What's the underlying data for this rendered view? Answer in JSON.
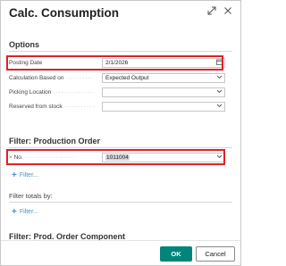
{
  "dialog": {
    "title": "Calc. Consumption"
  },
  "options": {
    "section_title": "Options",
    "posting_date": {
      "label": "Posting Date",
      "value": "2/1/2026",
      "icon": "calendar-icon"
    },
    "calculation_based_on": {
      "label": "Calculation Based on",
      "value": "Expected Output",
      "icon": "chevron-down-icon"
    },
    "picking_location": {
      "label": "Picking Location",
      "value": "",
      "icon": "chevron-down-icon"
    },
    "reserved_from_stock": {
      "label": "Reserved from stock",
      "value": "",
      "icon": "chevron-down-icon"
    }
  },
  "filter_production_order": {
    "section_title": "Filter: Production Order",
    "no": {
      "label": "No.",
      "value": "1011004",
      "icon": "chevron-down-icon"
    },
    "add_filter_label": "Filter..."
  },
  "filter_totals": {
    "title": "Filter totals by:",
    "add_filter_label": "Filter..."
  },
  "filter_prod_order_component": {
    "section_title": "Filter: Prod. Order Component"
  },
  "footer": {
    "ok_label": "OK",
    "cancel_label": "Cancel"
  },
  "colors": {
    "highlight": "#e0202a",
    "primary_button": "#00857b",
    "link": "#4a8fd4"
  }
}
